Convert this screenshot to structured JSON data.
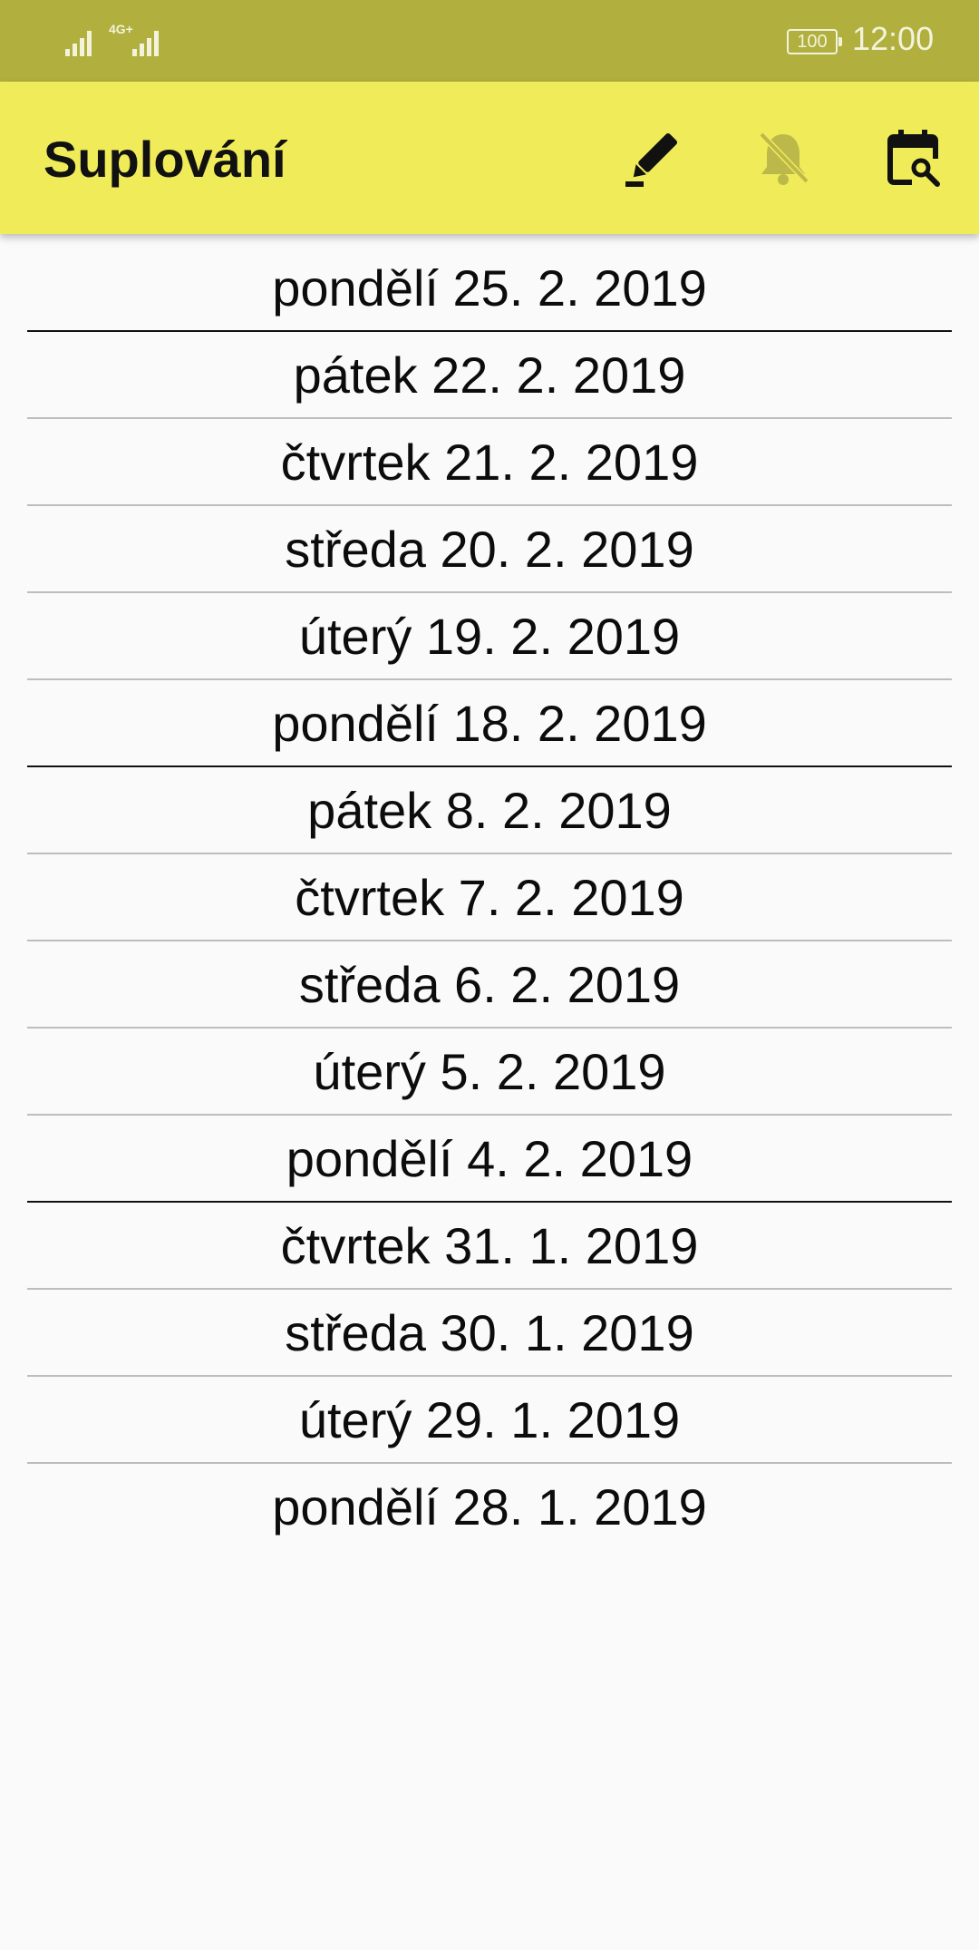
{
  "status_bar": {
    "network": "4G+",
    "battery": "100",
    "time": "12:00"
  },
  "app_bar": {
    "title": "Suplování",
    "actions": {
      "edit_icon": "pencil-icon",
      "notifications_icon": "bell-off-icon",
      "calendar_icon": "calendar-search-icon"
    }
  },
  "colors": {
    "status_bar": "#b1af3d",
    "app_bar": "#f0eb59",
    "muted_icon": "#bdb84a"
  },
  "days": [
    {
      "label": "pondělí 25. 2. 2019"
    },
    {
      "label": "pátek 22. 2. 2019"
    },
    {
      "label": "čtvrtek 21. 2. 2019"
    },
    {
      "label": "středa 20. 2. 2019"
    },
    {
      "label": "úterý 19. 2. 2019"
    },
    {
      "label": "pondělí 18. 2. 2019"
    },
    {
      "label": "pátek 8. 2. 2019"
    },
    {
      "label": "čtvrtek 7. 2. 2019"
    },
    {
      "label": "středa 6. 2. 2019"
    },
    {
      "label": "úterý 5. 2. 2019"
    },
    {
      "label": "pondělí 4. 2. 2019"
    },
    {
      "label": "čtvrtek 31. 1. 2019"
    },
    {
      "label": "středa 30. 1. 2019"
    },
    {
      "label": "úterý 29. 1. 2019"
    },
    {
      "label": "pondělí 28. 1. 2019"
    }
  ]
}
